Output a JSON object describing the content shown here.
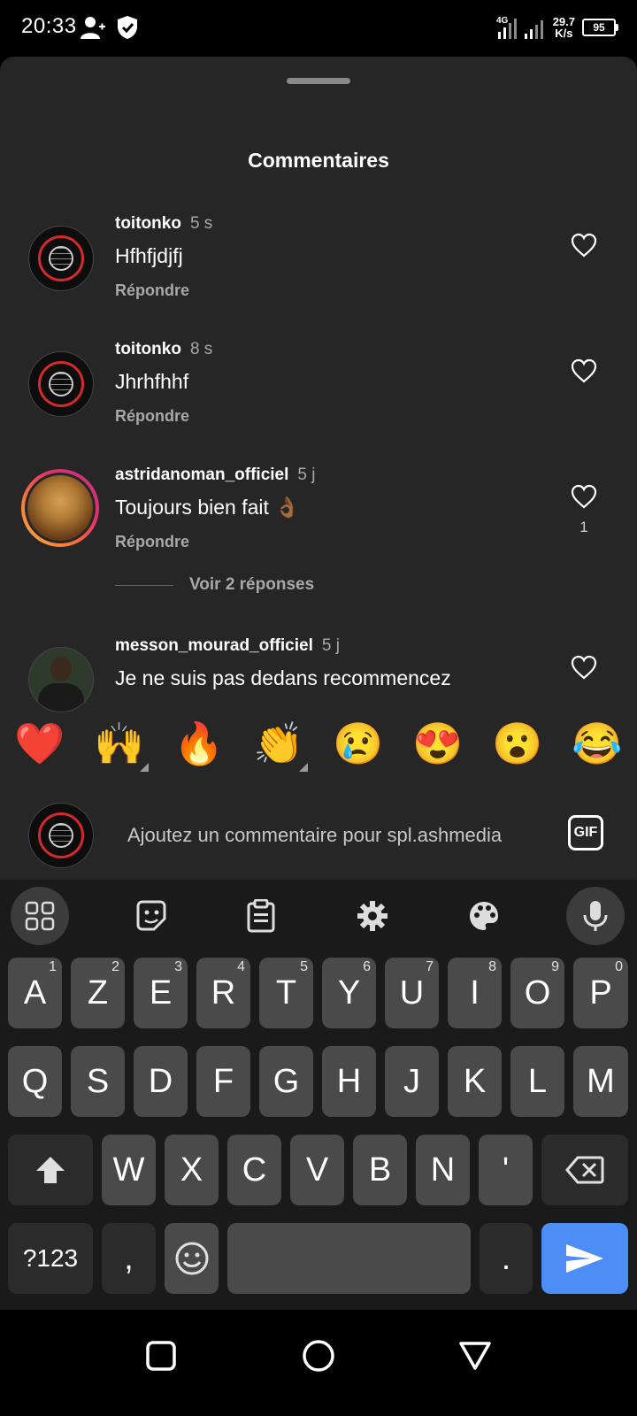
{
  "status_bar": {
    "time": "20:33",
    "network": "4G",
    "speed_value": "29.7",
    "speed_unit": "K/s",
    "battery": "95",
    "icons": [
      "person-add-icon",
      "shield-check-icon",
      "signal-icon"
    ]
  },
  "sheet": {
    "title": "Commentaires"
  },
  "comments": [
    {
      "user": "toitonko",
      "time": "5 s",
      "text": "Hfhfjdjfj",
      "reply": "Répondre",
      "likes": ""
    },
    {
      "user": "toitonko",
      "time": "8 s",
      "text": "Jhrhfhhf",
      "reply": "Répondre",
      "likes": ""
    },
    {
      "user": "astridanoman_officiel",
      "time": "5 j",
      "text": "Toujours bien fait 👌🏾",
      "reply": "Répondre",
      "likes": "1",
      "view_replies": "Voir 2 réponses"
    },
    {
      "user": "messon_mourad_officiel",
      "time": "5 j",
      "text": "Je ne suis pas dedans recommencez"
    }
  ],
  "emoji_bar": [
    "❤️",
    "🙌",
    "🔥",
    "👏",
    "😢",
    "😍",
    "😮",
    "😂"
  ],
  "comment_input": {
    "placeholder": "Ajoutez un commentaire pour spl.ashmedia",
    "gif_label": "GIF"
  },
  "keyboard": {
    "row1": [
      {
        "k": "A",
        "h": "1"
      },
      {
        "k": "Z",
        "h": "2"
      },
      {
        "k": "E",
        "h": "3"
      },
      {
        "k": "R",
        "h": "4"
      },
      {
        "k": "T",
        "h": "5"
      },
      {
        "k": "Y",
        "h": "6"
      },
      {
        "k": "U",
        "h": "7"
      },
      {
        "k": "I",
        "h": "8"
      },
      {
        "k": "O",
        "h": "9"
      },
      {
        "k": "P",
        "h": "0"
      }
    ],
    "row2": [
      "Q",
      "S",
      "D",
      "F",
      "G",
      "H",
      "J",
      "K",
      "L",
      "M"
    ],
    "row3": [
      "W",
      "X",
      "C",
      "V",
      "B",
      "N",
      "'"
    ],
    "sym_label": "?123",
    "comma": ",",
    "period": "."
  }
}
